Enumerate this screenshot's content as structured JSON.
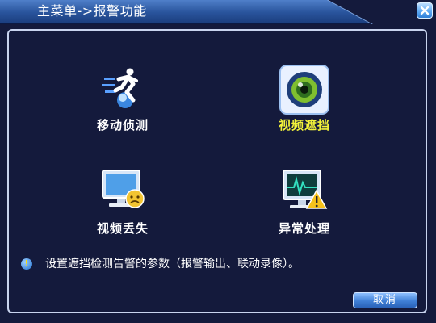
{
  "window": {
    "title": "主菜单->报警功能",
    "close_icon": "close-icon"
  },
  "menu": {
    "items": [
      {
        "id": "motion-detect",
        "label": "移动侦测",
        "icon": "running-man-icon",
        "active": false
      },
      {
        "id": "video-blind",
        "label": "视频遮挡",
        "icon": "camera-eye-icon",
        "active": true
      },
      {
        "id": "video-loss",
        "label": "视频丢失",
        "icon": "monitor-sad-face-icon",
        "active": false
      },
      {
        "id": "abnormal",
        "label": "异常处理",
        "icon": "monitor-warning-icon",
        "active": false
      }
    ]
  },
  "info": {
    "icon": "info-icon",
    "text": "设置遮挡检测告警的参数（报警输出、联动录像）。"
  },
  "footer": {
    "cancel_label": "取消"
  },
  "colors": {
    "background": "#141a3c",
    "title_bar": "#29549c",
    "active_label": "#f2f23a",
    "button": "#3f7fd6"
  }
}
